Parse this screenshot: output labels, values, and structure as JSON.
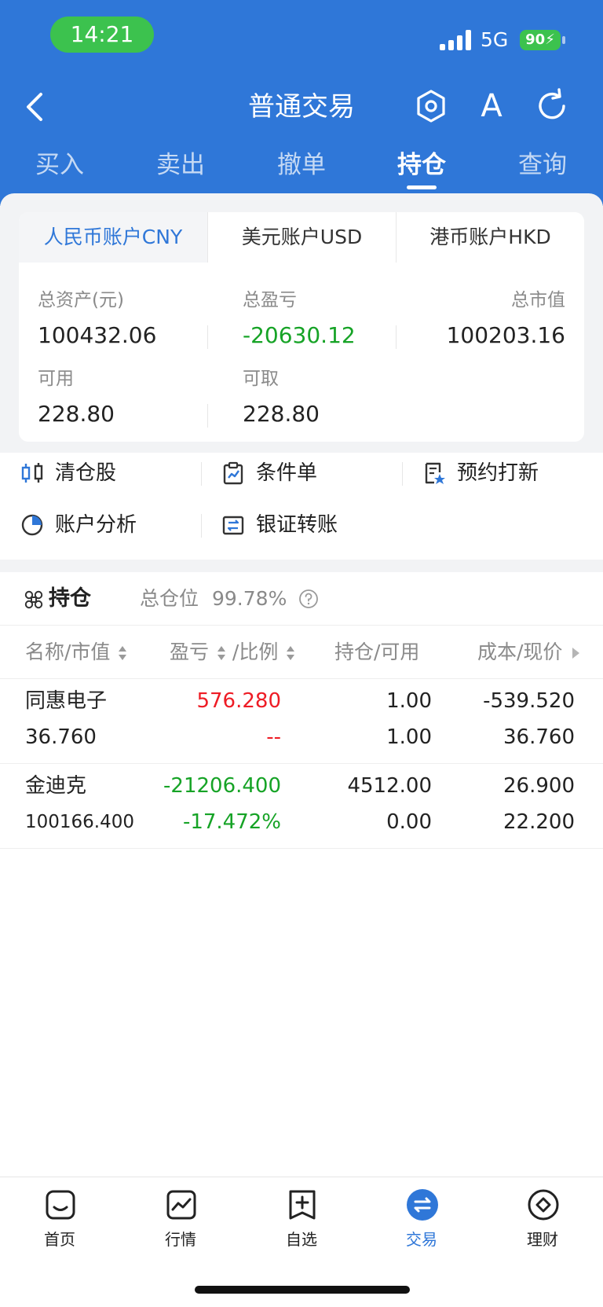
{
  "status_bar": {
    "time": "14:21",
    "network": "5G",
    "battery": "90"
  },
  "nav": {
    "title": "普通交易"
  },
  "tabs": [
    {
      "label": "买入"
    },
    {
      "label": "卖出"
    },
    {
      "label": "撤单"
    },
    {
      "label": "持仓"
    },
    {
      "label": "查询"
    }
  ],
  "active_tab": "持仓",
  "font_icon_glyph": "A",
  "accounts": [
    {
      "label": "人民币账户CNY"
    },
    {
      "label": "美元账户USD"
    },
    {
      "label": "港币账户HKD"
    }
  ],
  "summary": {
    "total_assets_label": "总资产(元)",
    "total_assets": "100432.06",
    "total_pl_label": "总盈亏",
    "total_pl": "-20630.12",
    "market_value_label": "总市值",
    "market_value": "100203.16",
    "available_label": "可用",
    "available": "228.80",
    "withdrawable_label": "可取",
    "withdrawable": "228.80"
  },
  "shortcuts": [
    {
      "label": "清仓股",
      "icon": "clear-position-icon"
    },
    {
      "label": "条件单",
      "icon": "conditional-order-icon"
    },
    {
      "label": "预约打新",
      "icon": "ipo-reservation-icon"
    },
    {
      "label": "账户分析",
      "icon": "pie-chart-icon"
    },
    {
      "label": "银证转账",
      "icon": "bank-transfer-icon"
    }
  ],
  "holdings": {
    "title": "持仓",
    "position_ratio_label": "总仓位",
    "position_ratio": "99.78%",
    "columns": {
      "name_value": "名称/市值",
      "pl_label": "盈亏",
      "ratio_label": "/比例",
      "position_available": "持仓/可用",
      "cost_price": "成本/现价"
    },
    "rows": [
      {
        "name": "同惠电子",
        "market_value": "36.760",
        "pl": "576.280",
        "pl_ratio": "--",
        "position": "1.00",
        "available": "1.00",
        "cost": "-539.520",
        "price": "36.760"
      },
      {
        "name": "金迪克",
        "market_value": "100166.400",
        "pl": "-21206.400",
        "pl_ratio": "-17.472%",
        "position": "4512.00",
        "available": "0.00",
        "cost": "26.900",
        "price": "22.200"
      }
    ]
  },
  "tabbar": [
    {
      "label": "首页",
      "icon": "home-icon"
    },
    {
      "label": "行情",
      "icon": "market-chart-icon"
    },
    {
      "label": "自选",
      "icon": "watchlist-add-icon"
    },
    {
      "label": "交易",
      "icon": "trade-exchange-icon"
    },
    {
      "label": "理财",
      "icon": "wealth-icon"
    }
  ],
  "colors": {
    "brand_blue": "#2f77d8",
    "gain_red": "#ee1c25",
    "loss_green": "#16a326",
    "status_green": "#3cc24e"
  }
}
